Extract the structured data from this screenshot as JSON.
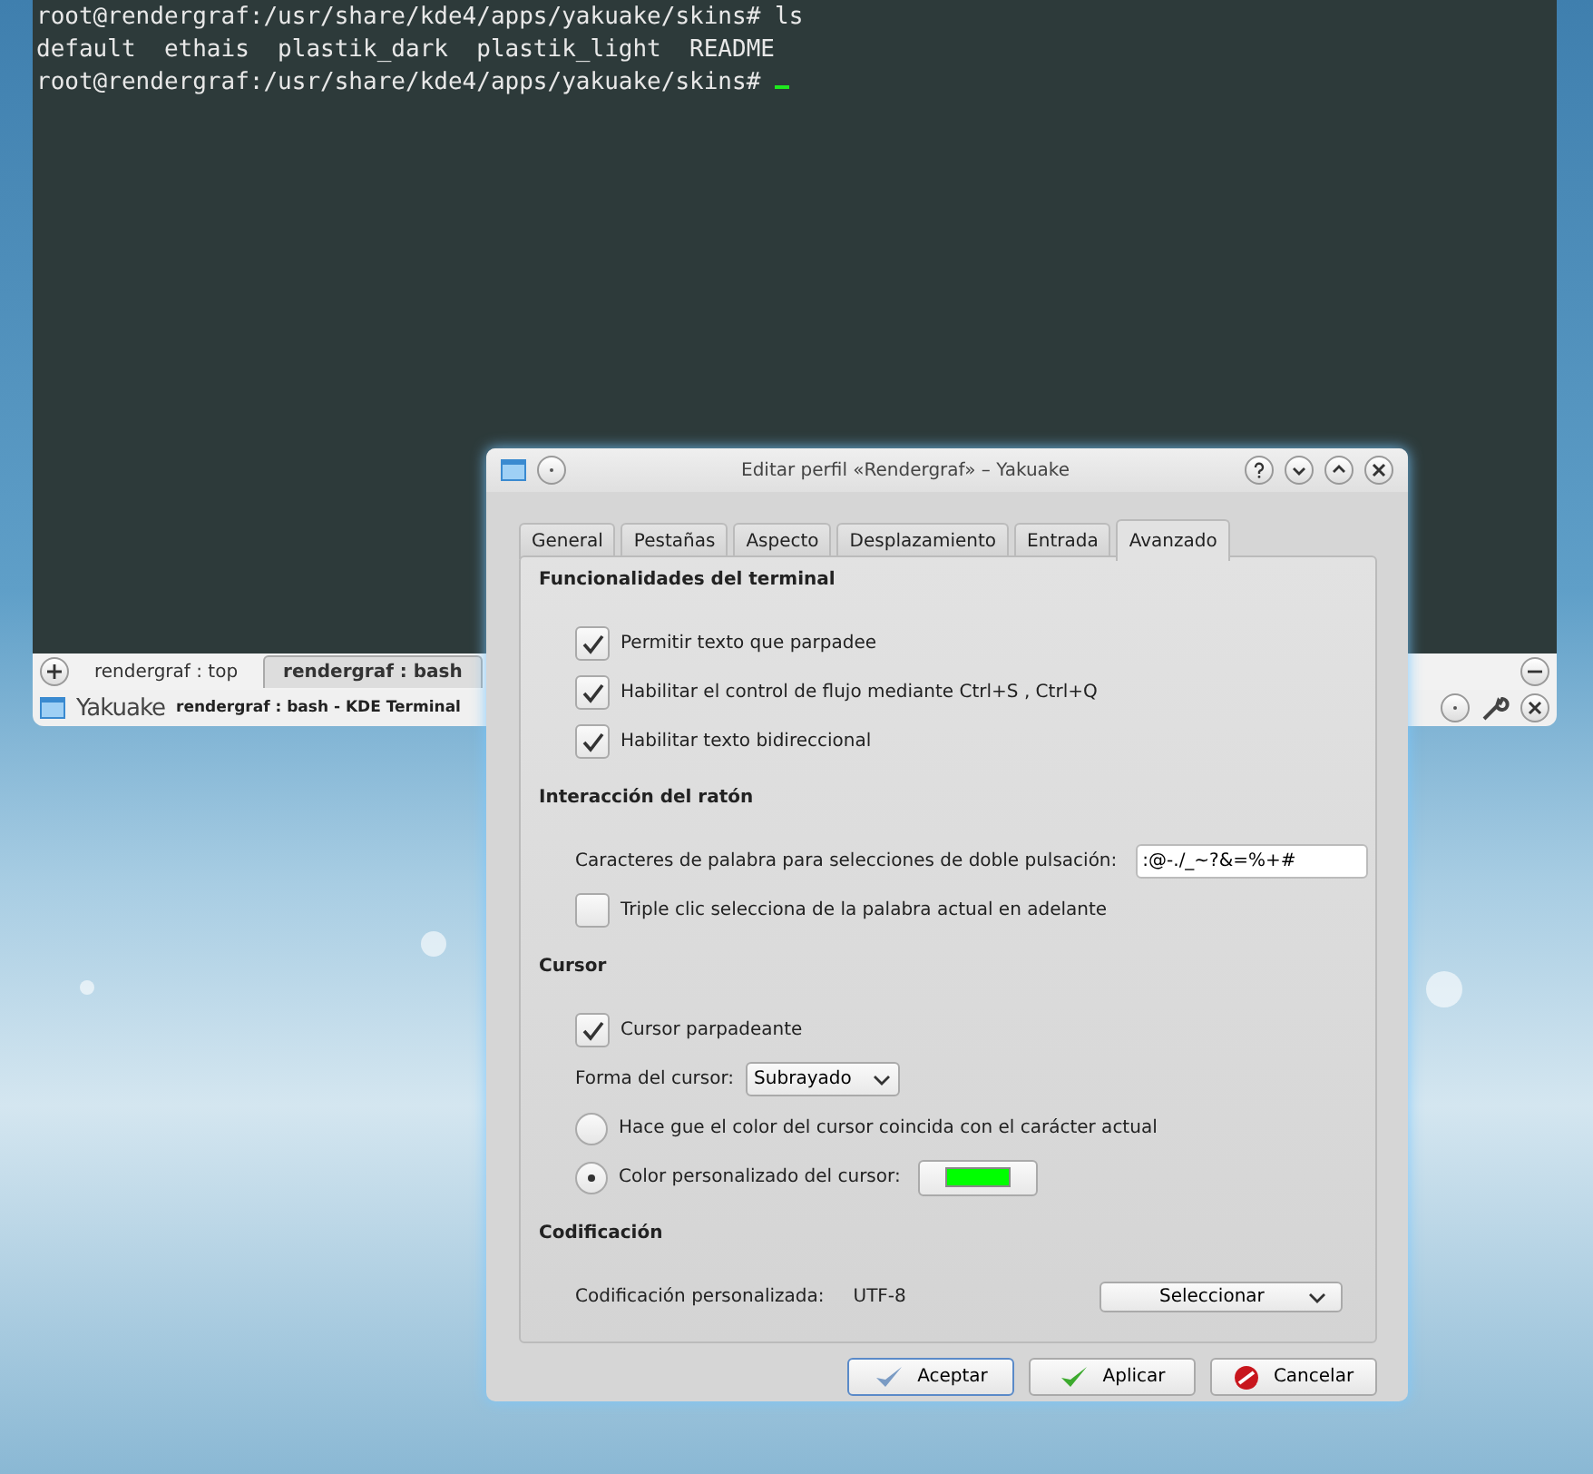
{
  "terminal": {
    "lines": [
      "root@rendergraf:/usr/share/kde4/apps/yakuake/skins# ls",
      "default  ethais  plastik_dark  plastik_light  README",
      "root@rendergraf:/usr/share/kde4/apps/yakuake/skins# "
    ],
    "tabs": [
      {
        "label": "rendergraf : top",
        "selected": false
      },
      {
        "label": "rendergraf : bash",
        "selected": true
      }
    ],
    "app_name": "Yakuake",
    "window_title": "rendergraf : bash - KDE Terminal"
  },
  "dialog": {
    "title": "Editar perfil «Rendergraf» – Yakuake",
    "tabs": [
      {
        "label": "General",
        "selected": false
      },
      {
        "label": "Pestañas",
        "selected": false
      },
      {
        "label": "Aspecto",
        "selected": false
      },
      {
        "label": "Desplazamiento",
        "selected": false
      },
      {
        "label": "Entrada",
        "selected": false
      },
      {
        "label": "Avanzado",
        "selected": true
      }
    ],
    "sections": [
      {
        "title": "Funcionalidades del terminal",
        "items": [
          {
            "kind": "checkbox",
            "label": "Permitir texto que parpadee",
            "checked": true
          },
          {
            "kind": "checkbox",
            "label": "Habilitar el control de flujo mediante Ctrl+S , Ctrl+Q",
            "checked": true
          },
          {
            "kind": "checkbox",
            "label": "Habilitar texto bidireccional",
            "checked": true
          }
        ]
      },
      {
        "title": "Interacción del ratón",
        "items": [
          {
            "kind": "text_field",
            "label": "Caracteres de palabra para selecciones de doble pulsación:",
            "value": ":@-./_~?&=%+#"
          },
          {
            "kind": "checkbox",
            "label": "Triple clic selecciona de la palabra actual en adelante",
            "checked": false
          }
        ]
      },
      {
        "title": "Cursor",
        "items": [
          {
            "kind": "checkbox",
            "label": "Cursor parpadeante",
            "checked": true
          },
          {
            "kind": "dropdown",
            "label": "Forma del cursor:",
            "value": "Subrayado"
          },
          {
            "kind": "radio",
            "label": "Hace gue el color del cursor coincida con el carácter actual",
            "selected": false
          },
          {
            "kind": "radio_color",
            "label": "Color personalizado del cursor:",
            "selected": true,
            "color": "#00ff00"
          }
        ]
      },
      {
        "title": "Codificación",
        "items": [
          {
            "kind": "encoding",
            "label": "Codificación personalizada:",
            "value": "UTF-8",
            "button": "Seleccionar"
          }
        ]
      }
    ],
    "buttons": [
      {
        "kind": "ok",
        "label": "Aceptar"
      },
      {
        "kind": "apply",
        "label": "Aplicar"
      },
      {
        "kind": "cancel",
        "label": "Cancelar"
      }
    ]
  }
}
